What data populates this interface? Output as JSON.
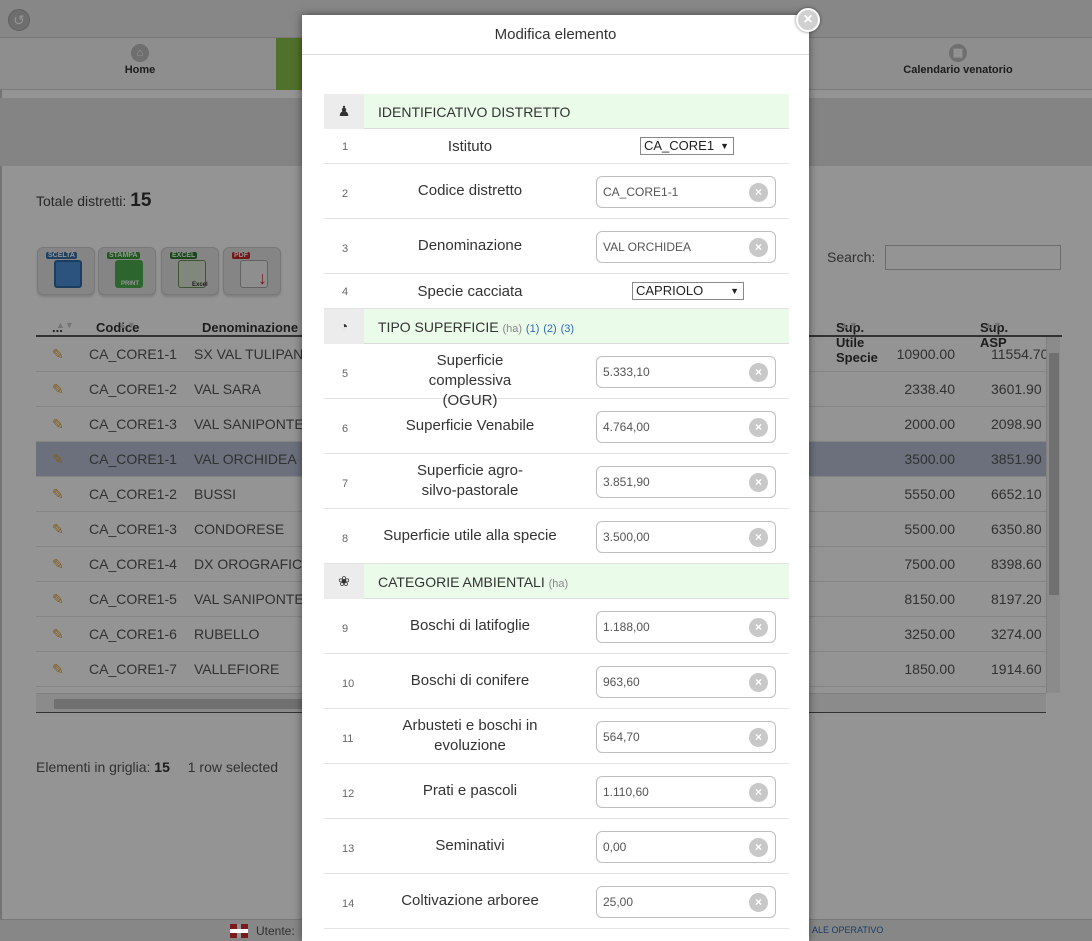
{
  "nav": {
    "items": [
      {
        "label": "Home",
        "icon": "home-icon"
      },
      {
        "label": "Calendario venatorio",
        "icon": "calendar-icon"
      }
    ]
  },
  "summary": {
    "total_label": "Totale distretti:",
    "total_value": "15"
  },
  "toolbar": {
    "scelta_label": "SCELTA",
    "stampa_label": "STAMPA",
    "print_label": "PRINT",
    "excel_label": "EXCEL",
    "excel_sub_label": "Excel",
    "pdf_label": "PDF"
  },
  "search": {
    "label": "Search:",
    "value": ""
  },
  "grid": {
    "columns": [
      "...",
      "Codice",
      "Denominazione",
      "Sup. Utile Specie",
      "Sup. ASP"
    ],
    "rows": [
      {
        "codice": "CA_CORE1-1",
        "denominazione": "SX VAL TULIPAN",
        "sup_utile": "10900.00",
        "sup_asp": "11554.70",
        "selected": false
      },
      {
        "codice": "CA_CORE1-2",
        "denominazione": "VAL SARA",
        "sup_utile": "2338.40",
        "sup_asp": "3601.90",
        "selected": false
      },
      {
        "codice": "CA_CORE1-3",
        "denominazione": "VAL SANIPONTE",
        "sup_utile": "2000.00",
        "sup_asp": "2098.90",
        "selected": false
      },
      {
        "codice": "CA_CORE1-1",
        "denominazione": "VAL ORCHIDEA",
        "sup_utile": "3500.00",
        "sup_asp": "3851.90",
        "selected": true
      },
      {
        "codice": "CA_CORE1-2",
        "denominazione": "BUSSI",
        "sup_utile": "5550.00",
        "sup_asp": "6652.10",
        "selected": false
      },
      {
        "codice": "CA_CORE1-3",
        "denominazione": "CONDORESE",
        "sup_utile": "5500.00",
        "sup_asp": "6350.80",
        "selected": false
      },
      {
        "codice": "CA_CORE1-4",
        "denominazione": "DX OROGRAFIC",
        "sup_utile": "7500.00",
        "sup_asp": "8398.60",
        "selected": false
      },
      {
        "codice": "CA_CORE1-5",
        "denominazione": "VAL SANIPONTE",
        "sup_utile": "8150.00",
        "sup_asp": "8197.20",
        "selected": false
      },
      {
        "codice": "CA_CORE1-6",
        "denominazione": "RUBELLO",
        "sup_utile": "3250.00",
        "sup_asp": "3274.00",
        "selected": false
      },
      {
        "codice": "CA_CORE1-7",
        "denominazione": "VALLEFIORE",
        "sup_utile": "1850.00",
        "sup_asp": "1914.60",
        "selected": false
      }
    ],
    "footer_label": "Elementi in griglia:",
    "footer_count": "15",
    "footer_selection": "1 row selected"
  },
  "status": {
    "user_label": "Utente:",
    "right_text": "ALE OPERATIVO"
  },
  "modal": {
    "title": "Modifica elemento",
    "close_label": "×",
    "sections": {
      "identificativo": {
        "label": "IDENTIFICATIVO DISTRETTO",
        "icon": "user-icon"
      },
      "superficie": {
        "label": "TIPO SUPERFICIE",
        "unit": "(ha)",
        "links": [
          "(1)",
          "(2)",
          "(3)"
        ],
        "icon": "gauge-icon"
      },
      "categorie": {
        "label": "CATEGORIE AMBIENTALI",
        "unit": "(ha)",
        "icon": "leaf-icon"
      }
    },
    "fields": [
      {
        "idx": "1",
        "label": "Istituto",
        "type": "select",
        "value": "CA_CORE1"
      },
      {
        "idx": "2",
        "label": "Codice distretto",
        "type": "text",
        "value": "CA_CORE1-1"
      },
      {
        "idx": "3",
        "label": "Denominazione",
        "type": "text",
        "value": "VAL ORCHIDEA"
      },
      {
        "idx": "4",
        "label": "Specie cacciata",
        "type": "select",
        "value": "CAPRIOLO"
      },
      {
        "idx": "5",
        "label": "Superficie complessiva (OGUR)",
        "type": "text",
        "value": "5.333,10"
      },
      {
        "idx": "6",
        "label": "Superficie Venabile",
        "type": "text",
        "value": "4.764,00"
      },
      {
        "idx": "7",
        "label": "Superficie agro-silvo-pastorale",
        "type": "text",
        "value": "3.851,90"
      },
      {
        "idx": "8",
        "label": "Superficie utile alla specie",
        "type": "text",
        "value": "3.500,00"
      },
      {
        "idx": "9",
        "label": "Boschi di latifoglie",
        "type": "text",
        "value": "1.188,00"
      },
      {
        "idx": "10",
        "label": "Boschi di conifere",
        "type": "text",
        "value": "963,60"
      },
      {
        "idx": "11",
        "label": "Arbusteti e boschi in evoluzione",
        "type": "text",
        "value": "564,70"
      },
      {
        "idx": "12",
        "label": "Prati e pascoli",
        "type": "text",
        "value": "1.110,60"
      },
      {
        "idx": "13",
        "label": "Seminativi",
        "type": "text",
        "value": "0,00"
      },
      {
        "idx": "14",
        "label": "Coltivazione arboree",
        "type": "text",
        "value": "25,00"
      }
    ]
  },
  "colors": {
    "accent_green": "#8bc34a",
    "section_bg": "#ebfbea",
    "selected_row": "#b9c2d6",
    "link_blue": "#2d6bb3"
  }
}
